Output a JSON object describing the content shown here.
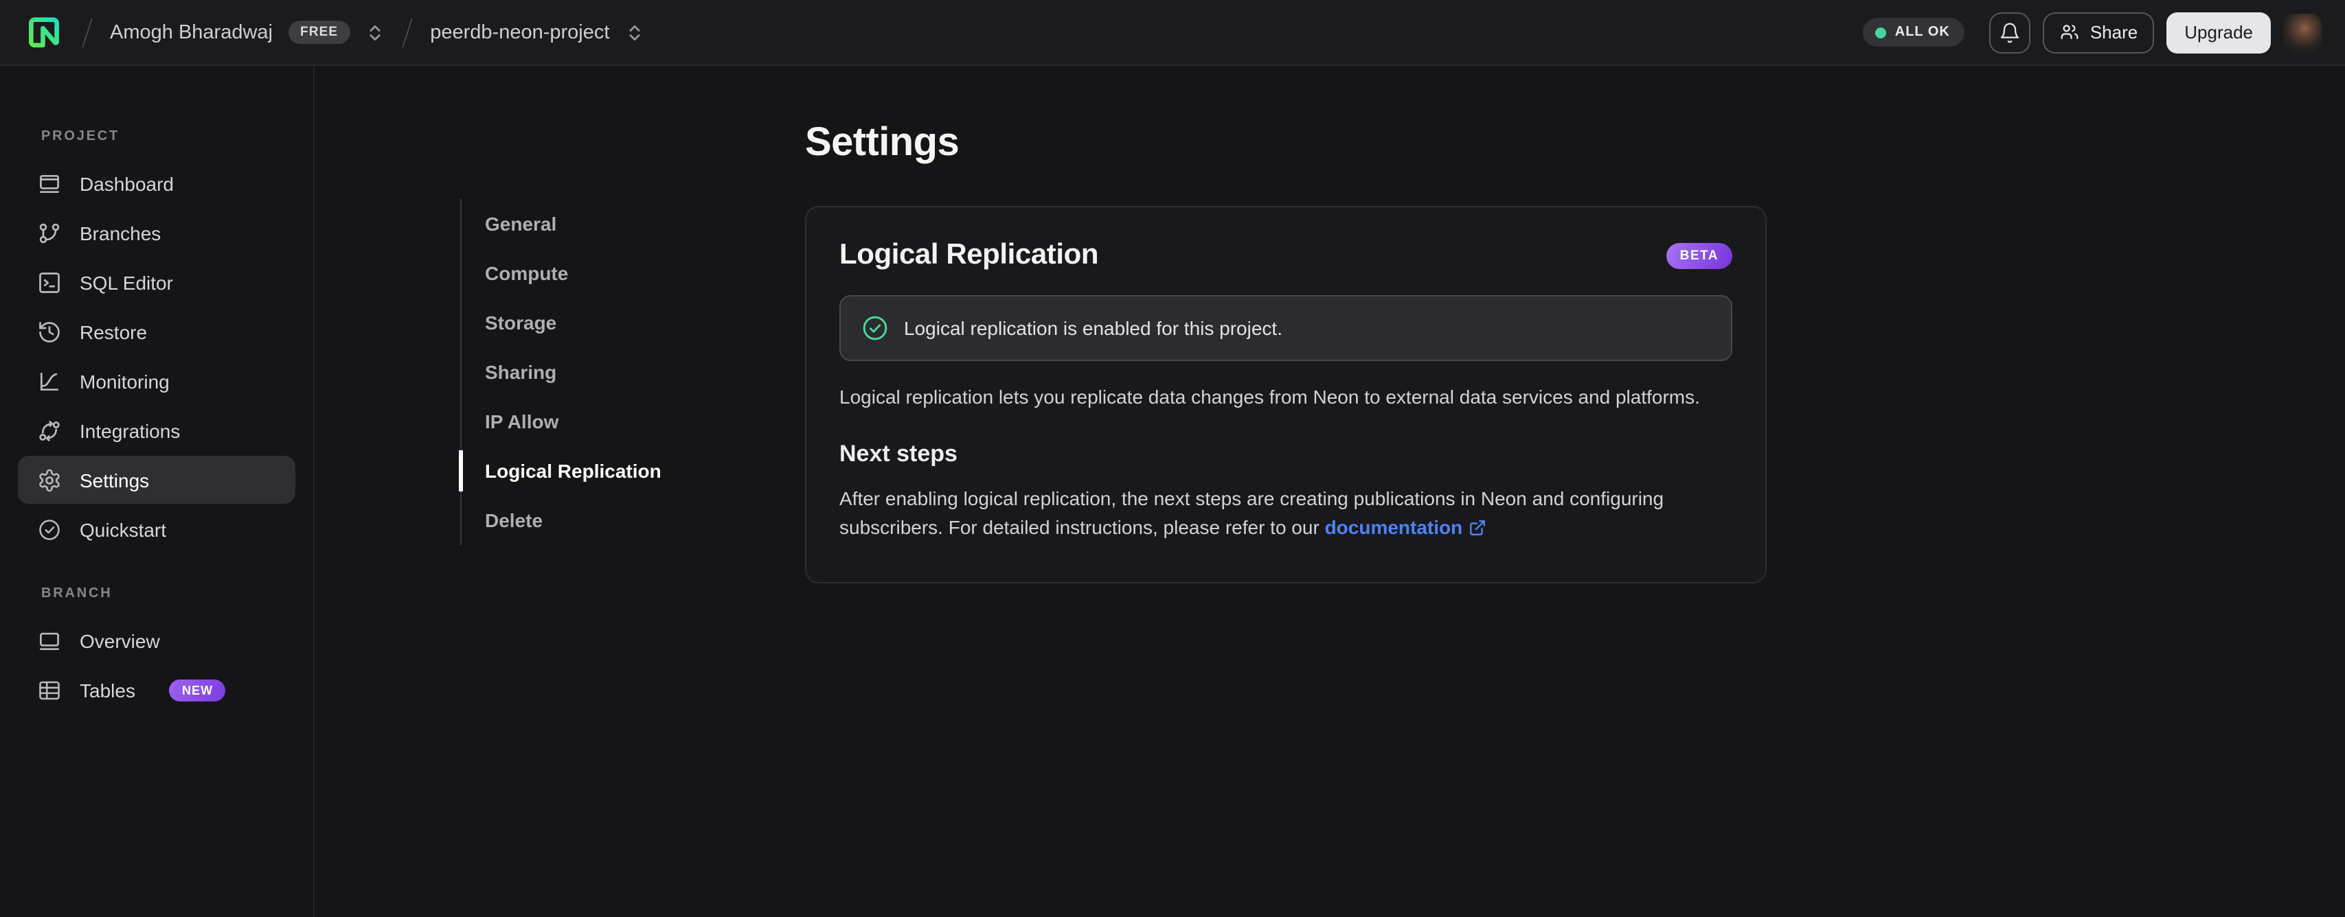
{
  "topbar": {
    "org_name": "Amogh Bharadwaj",
    "plan_badge": "FREE",
    "project_name": "peerdb-neon-project",
    "status_label": "ALL OK",
    "share_label": "Share",
    "upgrade_label": "Upgrade"
  },
  "sidebar": {
    "sections": [
      {
        "label": "PROJECT",
        "items": [
          {
            "label": "Dashboard",
            "icon": "dashboard-icon"
          },
          {
            "label": "Branches",
            "icon": "git-branch-icon"
          },
          {
            "label": "SQL Editor",
            "icon": "terminal-icon"
          },
          {
            "label": "Restore",
            "icon": "history-icon"
          },
          {
            "label": "Monitoring",
            "icon": "chart-icon"
          },
          {
            "label": "Integrations",
            "icon": "integrations-icon"
          },
          {
            "label": "Settings",
            "icon": "gear-icon",
            "active": true
          },
          {
            "label": "Quickstart",
            "icon": "check-circle-icon"
          }
        ]
      },
      {
        "label": "BRANCH",
        "items": [
          {
            "label": "Overview",
            "icon": "window-icon"
          },
          {
            "label": "Tables",
            "icon": "table-icon",
            "badge": "NEW"
          }
        ]
      }
    ]
  },
  "settings_nav": {
    "items": [
      {
        "label": "General"
      },
      {
        "label": "Compute"
      },
      {
        "label": "Storage"
      },
      {
        "label": "Sharing"
      },
      {
        "label": "IP Allow"
      },
      {
        "label": "Logical Replication",
        "active": true
      },
      {
        "label": "Delete"
      }
    ]
  },
  "main": {
    "page_title": "Settings",
    "card": {
      "title": "Logical Replication",
      "badge": "BETA",
      "banner_text": "Logical replication is enabled for this project.",
      "description": "Logical replication lets you replicate data changes from Neon to external data services and platforms.",
      "next_steps_title": "Next steps",
      "next_steps_text": "After enabling logical replication, the next steps are creating publications in Neon and configuring subscribers. For detailed instructions, please refer to our ",
      "doc_link_label": "documentation"
    }
  },
  "colors": {
    "brand_teal": "#1edec0",
    "brand_green": "#63e94d",
    "status_green": "#42d6a0",
    "badge_purple": "#7c3ce0",
    "link_blue": "#4f82f4"
  }
}
